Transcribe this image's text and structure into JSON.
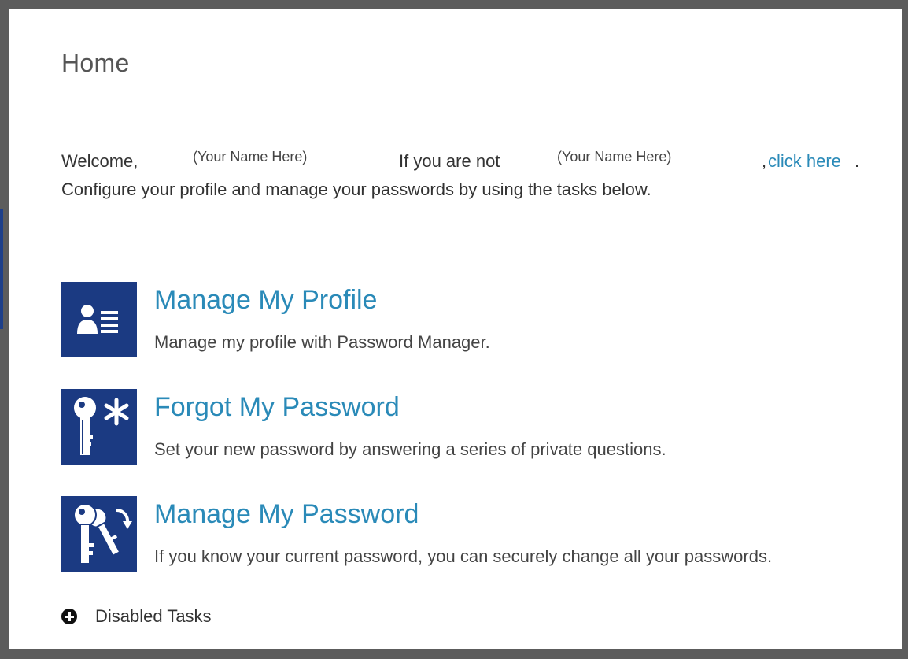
{
  "header": {
    "title": "Home"
  },
  "welcome": {
    "greeting": "Welcome,",
    "user_name": "(Your Name Here)",
    "not_user_text": "If you are not",
    "not_user_name": "(Your Name Here)",
    "separator": ",",
    "switch_user_link": "click here",
    "period": ".",
    "instructions": "Configure your profile and manage your passwords by using the tasks below."
  },
  "tasks": [
    {
      "icon": "profile-icon",
      "title": "Manage My Profile",
      "description": "Manage my profile with Password Manager."
    },
    {
      "icon": "key-asterisk-icon",
      "title": "Forgot My Password",
      "description": "Set your new password by answering a series of private questions."
    },
    {
      "icon": "keys-refresh-icon",
      "title": "Manage My Password",
      "description": "If you know your current password, you can securely change all your passwords."
    }
  ],
  "disabled_tasks": {
    "icon": "plus-circle-icon",
    "label": "Disabled Tasks"
  },
  "colors": {
    "frame": "#5c5c5c",
    "accent": "#2a8ab8",
    "icon_bg": "#1b3a82"
  }
}
